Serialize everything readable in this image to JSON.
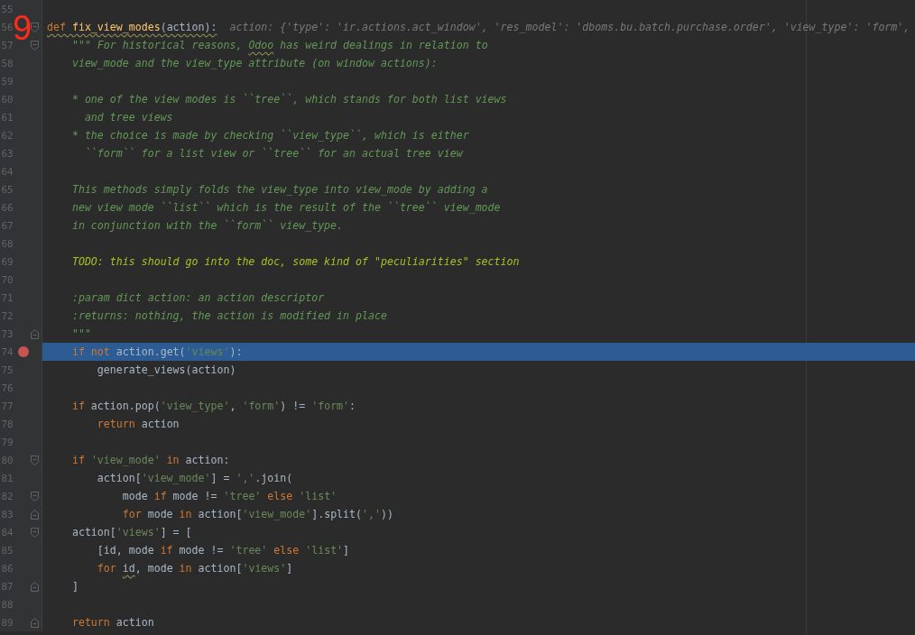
{
  "annotation": "9",
  "lines": [
    {
      "number": "55",
      "selected": false,
      "breakpoint": false,
      "fold_start": false,
      "fold_end": false
    },
    {
      "number": "56",
      "selected": false,
      "breakpoint": false,
      "fold_start": true,
      "fold_end": false,
      "warning": true,
      "tokens": [
        {
          "kind": "kw",
          "text": "def "
        },
        {
          "kind": "fn",
          "text": "fix_view_modes"
        },
        {
          "kind": "plain",
          "text": "(action):"
        }
      ],
      "hint": "action: {'type': 'ir.actions.act_window', 'res_model': 'dboms.bu.batch.purchase.order', 'view_type': 'form',"
    },
    {
      "number": "57",
      "selected": false,
      "breakpoint": false,
      "fold_start": true,
      "fold_end": false,
      "warning": false,
      "tokens": [
        {
          "kind": "doc",
          "text": "    \"\"\" For historical reasons, "
        },
        {
          "kind": "doc",
          "text": "Odoo",
          "warning": true
        },
        {
          "kind": "doc",
          "text": " has weird dealings in relation to"
        }
      ]
    },
    {
      "number": "58",
      "selected": false,
      "breakpoint": false,
      "fold_start": false,
      "fold_end": false,
      "warning": false,
      "tokens": [
        {
          "kind": "doc",
          "text": "    view_mode and the view_type attribute (on window actions):"
        }
      ]
    },
    {
      "number": "59",
      "selected": false,
      "breakpoint": false,
      "fold_start": false,
      "fold_end": false
    },
    {
      "number": "60",
      "selected": false,
      "breakpoint": false,
      "fold_start": false,
      "fold_end": false,
      "warning": false,
      "tokens": [
        {
          "kind": "doc",
          "text": "    * one of the view modes is ``tree``, which stands for both list views"
        }
      ]
    },
    {
      "number": "61",
      "selected": false,
      "breakpoint": false,
      "fold_start": false,
      "fold_end": false,
      "warning": false,
      "tokens": [
        {
          "kind": "doc",
          "text": "      and tree views"
        }
      ]
    },
    {
      "number": "62",
      "selected": false,
      "breakpoint": false,
      "fold_start": false,
      "fold_end": false,
      "warning": false,
      "tokens": [
        {
          "kind": "doc",
          "text": "    * the choice is made by checking ``view_type``, which is either"
        }
      ]
    },
    {
      "number": "63",
      "selected": false,
      "breakpoint": false,
      "fold_start": false,
      "fold_end": false,
      "warning": false,
      "tokens": [
        {
          "kind": "doc",
          "text": "      ``form`` for a list view or ``tree`` for an actual tree view"
        }
      ]
    },
    {
      "number": "64",
      "selected": false,
      "breakpoint": false,
      "fold_start": false,
      "fold_end": false
    },
    {
      "number": "65",
      "selected": false,
      "breakpoint": false,
      "fold_start": false,
      "fold_end": false,
      "warning": false,
      "tokens": [
        {
          "kind": "doc",
          "text": "    This methods simply folds the view_type into view_mode by adding a"
        }
      ]
    },
    {
      "number": "66",
      "selected": false,
      "breakpoint": false,
      "fold_start": false,
      "fold_end": false,
      "warning": false,
      "tokens": [
        {
          "kind": "doc",
          "text": "    new view mode ``list`` which is the result of the ``tree`` view_mode"
        }
      ]
    },
    {
      "number": "67",
      "selected": false,
      "breakpoint": false,
      "fold_start": false,
      "fold_end": false,
      "warning": false,
      "tokens": [
        {
          "kind": "doc",
          "text": "    in conjunction with the ``form`` view_type."
        }
      ]
    },
    {
      "number": "68",
      "selected": false,
      "breakpoint": false,
      "fold_start": false,
      "fold_end": false
    },
    {
      "number": "69",
      "selected": false,
      "breakpoint": false,
      "fold_start": false,
      "fold_end": false,
      "warning": false,
      "tokens": [
        {
          "kind": "todo",
          "text": "    TODO: this should go into the doc, some kind of \"peculiarities\" section"
        }
      ]
    },
    {
      "number": "70",
      "selected": false,
      "breakpoint": false,
      "fold_start": false,
      "fold_end": false
    },
    {
      "number": "71",
      "selected": false,
      "breakpoint": false,
      "fold_start": false,
      "fold_end": false,
      "warning": false,
      "tokens": [
        {
          "kind": "doc",
          "text": "    :param dict action: an action descriptor"
        }
      ]
    },
    {
      "number": "72",
      "selected": false,
      "breakpoint": false,
      "fold_start": false,
      "fold_end": false,
      "warning": false,
      "tokens": [
        {
          "kind": "doc",
          "text": "    :returns: nothing, the action is modified in place"
        }
      ]
    },
    {
      "number": "73",
      "selected": false,
      "breakpoint": false,
      "fold_start": false,
      "fold_end": true,
      "warning": false,
      "tokens": [
        {
          "kind": "doc",
          "text": "    \"\"\""
        }
      ]
    },
    {
      "number": "74",
      "selected": true,
      "breakpoint": true,
      "fold_start": false,
      "fold_end": false,
      "warning": false,
      "tokens": [
        {
          "kind": "kw",
          "text": "    if not"
        },
        {
          "kind": "plain",
          "text": " action.get("
        },
        {
          "kind": "str",
          "text": "'views'"
        },
        {
          "kind": "plain",
          "text": "):"
        }
      ]
    },
    {
      "number": "75",
      "selected": false,
      "breakpoint": false,
      "fold_start": false,
      "fold_end": false,
      "warning": false,
      "tokens": [
        {
          "kind": "plain",
          "text": "        generate_views(action)"
        }
      ]
    },
    {
      "number": "76",
      "selected": false,
      "breakpoint": false,
      "fold_start": false,
      "fold_end": false
    },
    {
      "number": "77",
      "selected": false,
      "breakpoint": false,
      "fold_start": false,
      "fold_end": false,
      "warning": false,
      "tokens": [
        {
          "kind": "kw",
          "text": "    if"
        },
        {
          "kind": "plain",
          "text": " action.pop("
        },
        {
          "kind": "str",
          "text": "'view_type'"
        },
        {
          "kind": "plain",
          "text": ", "
        },
        {
          "kind": "str",
          "text": "'form'"
        },
        {
          "kind": "plain",
          "text": ") != "
        },
        {
          "kind": "str",
          "text": "'form'"
        },
        {
          "kind": "plain",
          "text": ":"
        }
      ]
    },
    {
      "number": "78",
      "selected": false,
      "breakpoint": false,
      "fold_start": false,
      "fold_end": false,
      "warning": false,
      "tokens": [
        {
          "kind": "kw",
          "text": "        return"
        },
        {
          "kind": "plain",
          "text": " action"
        }
      ]
    },
    {
      "number": "79",
      "selected": false,
      "breakpoint": false,
      "fold_start": false,
      "fold_end": false
    },
    {
      "number": "80",
      "selected": false,
      "breakpoint": false,
      "fold_start": true,
      "fold_end": false,
      "warning": false,
      "tokens": [
        {
          "kind": "kw",
          "text": "    if "
        },
        {
          "kind": "str",
          "text": "'view_mode'"
        },
        {
          "kind": "kw",
          "text": " in"
        },
        {
          "kind": "plain",
          "text": " action:"
        }
      ]
    },
    {
      "number": "81",
      "selected": false,
      "breakpoint": false,
      "fold_start": false,
      "fold_end": false,
      "warning": false,
      "tokens": [
        {
          "kind": "plain",
          "text": "        action["
        },
        {
          "kind": "str",
          "text": "'view_mode'"
        },
        {
          "kind": "plain",
          "text": "] = "
        },
        {
          "kind": "str",
          "text": "','"
        },
        {
          "kind": "plain",
          "text": ".join("
        }
      ]
    },
    {
      "number": "82",
      "selected": false,
      "breakpoint": false,
      "fold_start": true,
      "fold_end": false,
      "warning": false,
      "tokens": [
        {
          "kind": "plain",
          "text": "            mode "
        },
        {
          "kind": "kw",
          "text": "if"
        },
        {
          "kind": "plain",
          "text": " mode != "
        },
        {
          "kind": "str",
          "text": "'tree'"
        },
        {
          "kind": "kw",
          "text": " else "
        },
        {
          "kind": "str",
          "text": "'list'"
        }
      ]
    },
    {
      "number": "83",
      "selected": false,
      "breakpoint": false,
      "fold_start": false,
      "fold_end": true,
      "warning": false,
      "tokens": [
        {
          "kind": "kw",
          "text": "            for"
        },
        {
          "kind": "plain",
          "text": " mode "
        },
        {
          "kind": "kw",
          "text": "in"
        },
        {
          "kind": "plain",
          "text": " action["
        },
        {
          "kind": "str",
          "text": "'view_mode'"
        },
        {
          "kind": "plain",
          "text": "].split("
        },
        {
          "kind": "str",
          "text": "','"
        },
        {
          "kind": "plain",
          "text": "))"
        }
      ]
    },
    {
      "number": "84",
      "selected": false,
      "breakpoint": false,
      "fold_start": true,
      "fold_end": false,
      "warning": false,
      "tokens": [
        {
          "kind": "plain",
          "text": "    action["
        },
        {
          "kind": "str",
          "text": "'views'"
        },
        {
          "kind": "plain",
          "text": "] = ["
        }
      ]
    },
    {
      "number": "85",
      "selected": false,
      "breakpoint": false,
      "fold_start": false,
      "fold_end": false,
      "warning": false,
      "tokens": [
        {
          "kind": "plain",
          "text": "        [id, mode "
        },
        {
          "kind": "kw",
          "text": "if"
        },
        {
          "kind": "plain",
          "text": " mode != "
        },
        {
          "kind": "str",
          "text": "'tree'"
        },
        {
          "kind": "kw",
          "text": " else "
        },
        {
          "kind": "str",
          "text": "'list'"
        },
        {
          "kind": "plain",
          "text": "]"
        }
      ]
    },
    {
      "number": "86",
      "selected": false,
      "breakpoint": false,
      "fold_start": false,
      "fold_end": false,
      "warning": false,
      "tokens": [
        {
          "kind": "kw",
          "text": "        for "
        },
        {
          "kind": "plain",
          "text": "id",
          "warning": true
        },
        {
          "kind": "plain",
          "text": ", mode "
        },
        {
          "kind": "kw",
          "text": "in"
        },
        {
          "kind": "plain",
          "text": " action["
        },
        {
          "kind": "str",
          "text": "'views'"
        },
        {
          "kind": "plain",
          "text": "]"
        }
      ]
    },
    {
      "number": "87",
      "selected": false,
      "breakpoint": false,
      "fold_start": false,
      "fold_end": true,
      "warning": false,
      "tokens": [
        {
          "kind": "plain",
          "text": "    ]"
        }
      ]
    },
    {
      "number": "88",
      "selected": false,
      "breakpoint": false,
      "fold_start": false,
      "fold_end": false
    },
    {
      "number": "89",
      "selected": false,
      "breakpoint": false,
      "fold_start": false,
      "fold_end": true,
      "warning": false,
      "tokens": [
        {
          "kind": "kw",
          "text": "    return"
        },
        {
          "kind": "plain",
          "text": " action"
        }
      ]
    }
  ]
}
